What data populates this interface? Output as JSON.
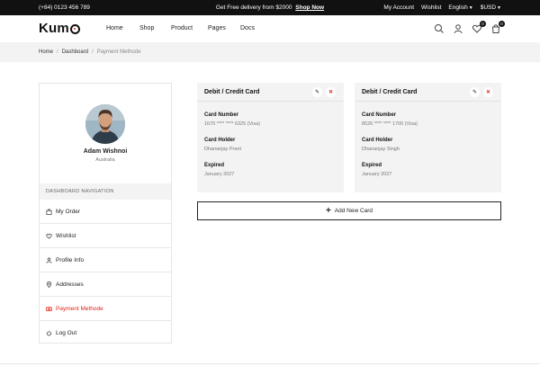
{
  "topbar": {
    "phone": "(+84) 0123 456 789",
    "promo_text": "Get Free delivery from $2000",
    "promo_link": "Shop Now",
    "my_account": "My Account",
    "wishlist": "Wishlist",
    "language": "English",
    "currency": "$USD"
  },
  "header": {
    "logo_text": "Kum",
    "nav": [
      "Home",
      "Shop",
      "Product",
      "Pages",
      "Docs"
    ],
    "wishlist_count": "0",
    "cart_count": "0"
  },
  "breadcrumb": [
    "Home",
    "Dashboard",
    "Payment Methode"
  ],
  "profile": {
    "name": "Adam Wishnoi",
    "country": "Australia"
  },
  "dashboard_nav": {
    "heading": "DASHBOARD NAVIGATION",
    "items": [
      {
        "label": "My Order",
        "icon": "bag-icon"
      },
      {
        "label": "Wishlist",
        "icon": "heart-icon"
      },
      {
        "label": "Profile Info",
        "icon": "user-icon"
      },
      {
        "label": "Addresses",
        "icon": "map-pin-icon"
      },
      {
        "label": "Payment Methode",
        "icon": "card-icon",
        "active": true
      },
      {
        "label": "Log Out",
        "icon": "power-icon"
      }
    ]
  },
  "cards": [
    {
      "title": "Debit / Credit Card",
      "number_label": "Card Number",
      "number": "1670 **** **** 6325 (Visa)",
      "holder_label": "Card Holder",
      "holder": "Dhananjay Preet",
      "expired_label": "Expired",
      "expired": "January 2027"
    },
    {
      "title": "Debit / Credit Card",
      "number_label": "Card Number",
      "number": "8526 **** **** 1700 (Visa)",
      "holder_label": "Card Holder",
      "holder": "Dhananjay Singh",
      "expired_label": "Expired",
      "expired": "January 2027"
    }
  ],
  "add_card_label": "Add New Card",
  "colors": {
    "accent": "#e2231a",
    "topbar": "#111111",
    "panel": "#f3f3f3"
  }
}
